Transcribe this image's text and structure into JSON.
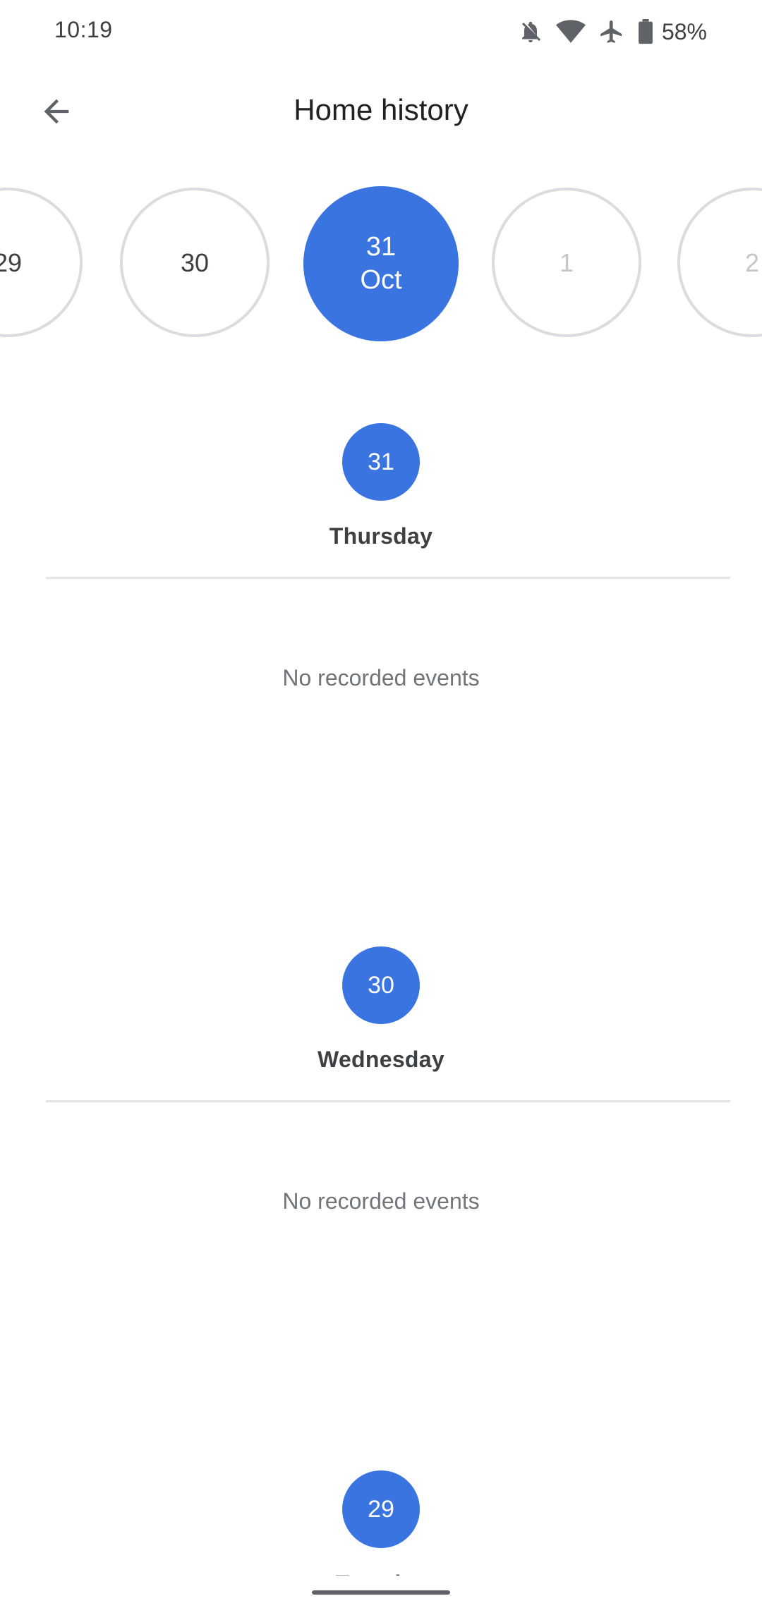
{
  "status_bar": {
    "time": "10:19",
    "battery_percent": "58%",
    "icons": [
      "notifications-off-icon",
      "wifi-icon",
      "airplane-mode-icon",
      "battery-icon"
    ]
  },
  "app_bar": {
    "title": "Home history",
    "back_icon": "arrow-back-icon"
  },
  "date_strip": {
    "dates": [
      {
        "day": "29",
        "month": ""
      },
      {
        "day": "30",
        "month": ""
      },
      {
        "day": "31",
        "month": "Oct"
      },
      {
        "day": "1",
        "month": ""
      },
      {
        "day": "2",
        "month": ""
      }
    ],
    "selected_index": 2
  },
  "days": [
    {
      "number": "31",
      "weekday": "Thursday",
      "empty_message": "No recorded events"
    },
    {
      "number": "30",
      "weekday": "Wednesday",
      "empty_message": "No recorded events"
    },
    {
      "number": "29",
      "weekday": "Tuesday"
    }
  ],
  "colors": {
    "accent": "#3a74e0",
    "border": "#dadce0",
    "muted_text": "#70757a"
  }
}
